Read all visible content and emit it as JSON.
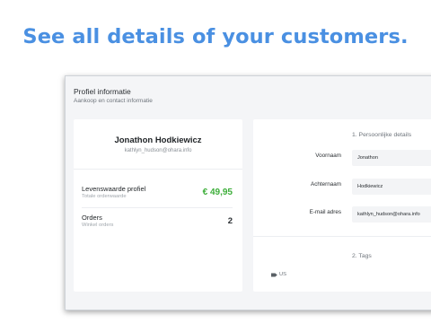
{
  "headline": "See all details of your customers.",
  "page": {
    "title": "Profiel informatie",
    "subtitle": "Aankoop en contact informatie"
  },
  "customer": {
    "name": "Jonathon Hodkiewicz",
    "email": "kathlyn_hudson@ohara.info"
  },
  "stats": [
    {
      "label": "Levenswaarde profiel",
      "sublabel": "Totale orderwaarde",
      "value": "€ 49,95",
      "color": "#3dae3a"
    },
    {
      "label": "Orders",
      "sublabel": "Winkel orders",
      "value": "2"
    }
  ],
  "personal": {
    "section_title": "1. Persoonlijke details",
    "fields": [
      {
        "label": "Voornaam",
        "value": "Jonathon"
      },
      {
        "label": "Achternaam",
        "value": "Hodkiewicz"
      },
      {
        "label": "E-mail adres",
        "value": "kathlyn_hudson@ohara.info"
      }
    ]
  },
  "tags": {
    "section_title": "2. Tags",
    "items": [
      {
        "label": "US",
        "icon": "tag-icon"
      }
    ]
  },
  "colors": {
    "headline": "#4a90e2",
    "positive": "#3dae3a",
    "background": "#f4f5f7"
  }
}
